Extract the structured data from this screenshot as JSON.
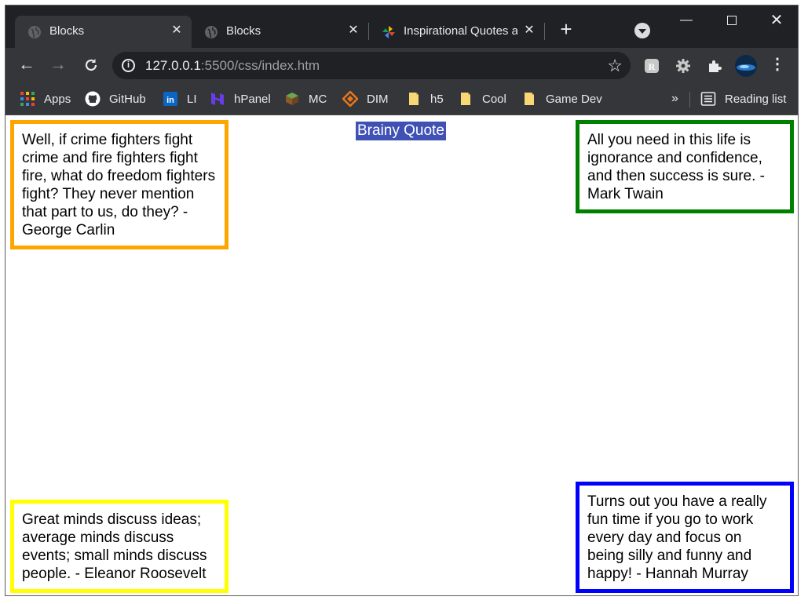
{
  "tabs": [
    {
      "title": "Blocks",
      "active": true
    },
    {
      "title": "Blocks",
      "active": false
    },
    {
      "title": "Inspirational Quotes a",
      "active": false
    }
  ],
  "address_bar": {
    "host": "127.0.0.1",
    "path": ":5500/css/index.htm"
  },
  "bookmarks": [
    "Apps",
    "GitHub",
    "LI",
    "hPanel",
    "MC",
    "DIM",
    "h5",
    "Cool",
    "Game Dev"
  ],
  "bookmarks_overflow": "»",
  "reading_list": "Reading list",
  "page": {
    "heading": "Brainy Quote",
    "quotes": {
      "top_left": {
        "text": "Well, if crime fighters fight crime and fire fighters fight fire, what do freedom fighters fight? They never mention that part to us, do they? - George Carlin",
        "border_color": "#ffa500"
      },
      "top_right": {
        "text": "All you need in this life is ignorance and confidence, and then success is sure. - Mark Twain",
        "border_color": "#008000"
      },
      "bottom_left": {
        "text": "Great minds discuss ideas; average minds discuss events; small minds discuss people. - Eleanor Roosevelt",
        "border_color": "#ffff00"
      },
      "bottom_right": {
        "text": "Turns out you have a really fun time if you go to work every day and focus on being silly and funny and happy! - Hannah Murray",
        "border_color": "#0000ff"
      }
    },
    "heading_bg": "#3f51b5"
  }
}
